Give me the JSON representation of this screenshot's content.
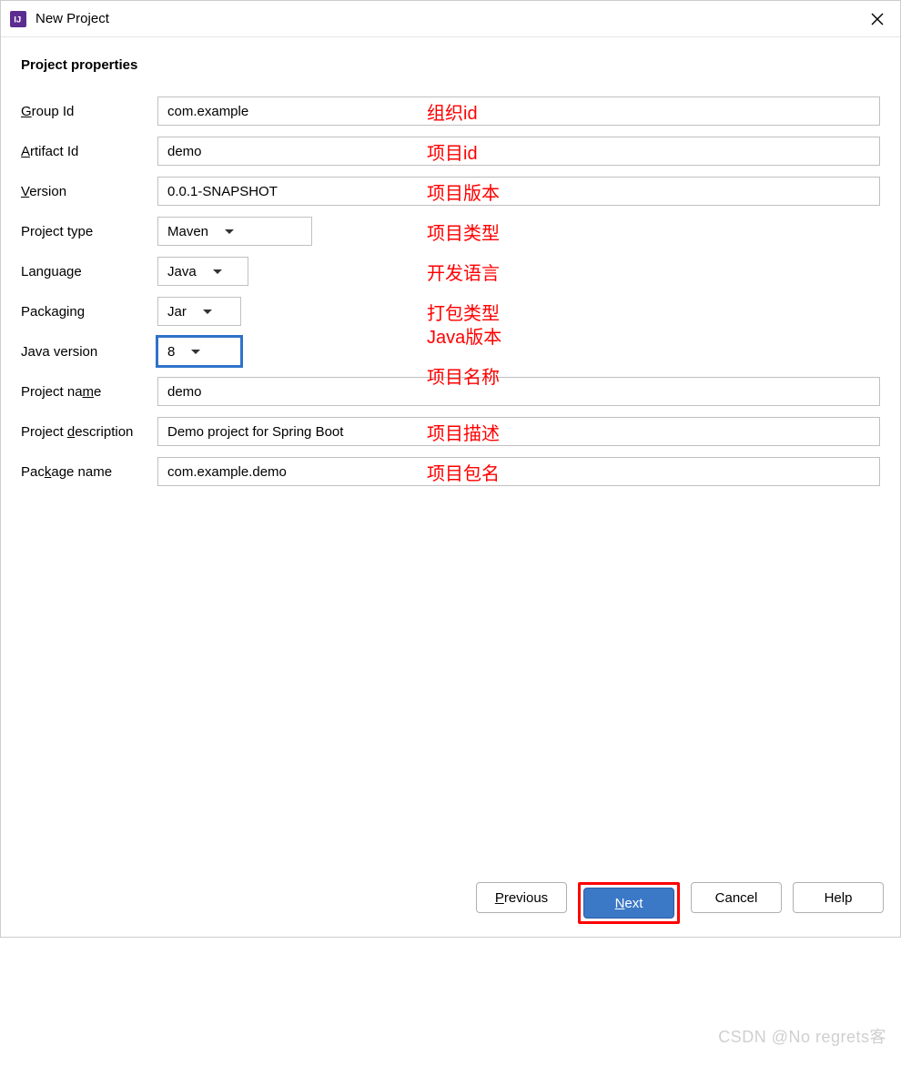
{
  "window": {
    "title": "New Project"
  },
  "heading": "Project properties",
  "fields": {
    "group_id": {
      "label_pre": "",
      "label_u": "G",
      "label_post": "roup Id",
      "value": "com.example"
    },
    "artifact_id": {
      "label_pre": "",
      "label_u": "A",
      "label_post": "rtifact Id",
      "value": "demo"
    },
    "version": {
      "label_pre": "",
      "label_u": "V",
      "label_post": "ersion",
      "value": "0.0.1-SNAPSHOT"
    },
    "project_type": {
      "label": "Project type",
      "value": "Maven"
    },
    "language": {
      "label": "Language",
      "value": "Java"
    },
    "packaging": {
      "label": "Packaging",
      "value": "Jar"
    },
    "java_version": {
      "label": "Java version",
      "value": "8"
    },
    "project_name": {
      "label_pre": "Project na",
      "label_u": "m",
      "label_post": "e",
      "value": "demo"
    },
    "project_desc": {
      "label_pre": "Project ",
      "label_u": "d",
      "label_post": "escription",
      "value": "Demo project for Spring Boot"
    },
    "package_name": {
      "label_pre": "Pac",
      "label_u": "k",
      "label_post": "age name",
      "value": "com.example.demo"
    }
  },
  "annotations": {
    "group_id": "组织id",
    "artifact_id": "项目id",
    "version": "项目版本",
    "project_type": "项目类型",
    "language": "开发语言",
    "packaging": "打包类型",
    "java_version": "Java版本",
    "project_name": "项目名称",
    "project_desc": "项目描述",
    "package_name": "项目包名"
  },
  "buttons": {
    "previous": {
      "pre": "",
      "u": "P",
      "post": "revious"
    },
    "next": {
      "pre": "",
      "u": "N",
      "post": "ext"
    },
    "cancel": "Cancel",
    "help": "Help"
  },
  "watermark": "CSDN @No regrets客"
}
